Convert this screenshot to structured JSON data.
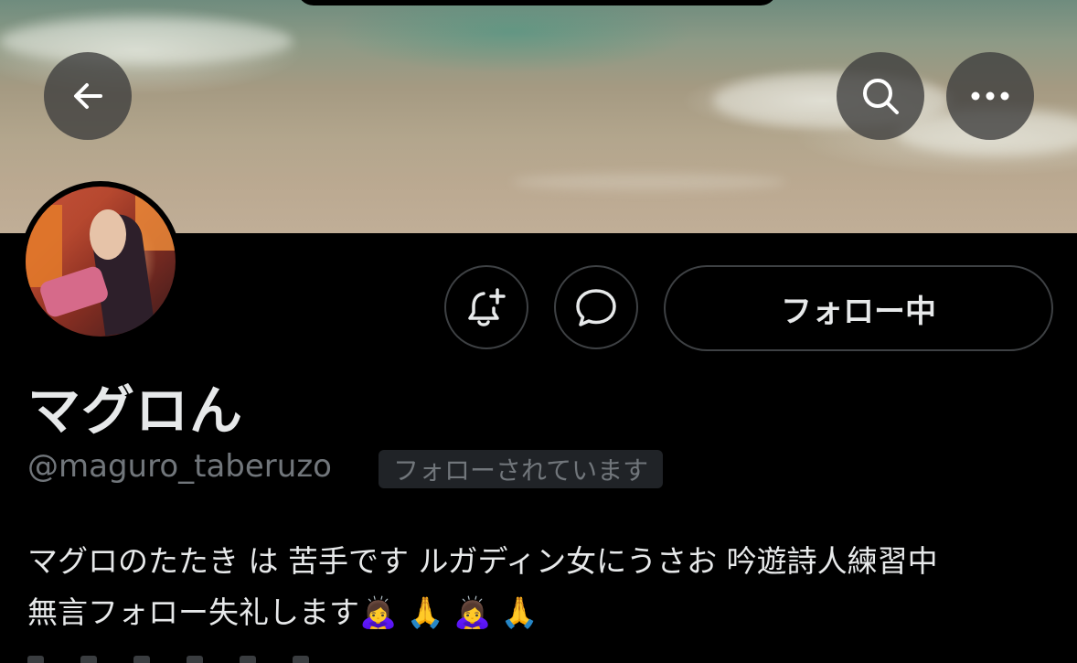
{
  "header": {
    "back_icon": "arrow-left-icon",
    "search_icon": "search-icon",
    "more_icon": "more-horizontal-icon"
  },
  "profile": {
    "display_name": "マグロん",
    "handle": "@maguro_taberuzo",
    "follows_you_badge": "フォローされています",
    "bio_line1": "マグロのたたき は 苦手です ルガディン女にうさお 吟遊詩人練習中",
    "bio_line2": "無言フォロー失礼します",
    "bio_emojis": [
      "🙇‍♀️",
      "🙏",
      "🙇‍♀️",
      "🙏"
    ]
  },
  "actions": {
    "notify_icon": "bell-plus-icon",
    "message_icon": "message-bubble-icon",
    "following_label": "フォロー中"
  },
  "colors": {
    "background": "#000000",
    "text_primary": "#e7e9ea",
    "text_secondary": "#71767b",
    "border": "#3e4144",
    "badge_bg": "#202327"
  }
}
